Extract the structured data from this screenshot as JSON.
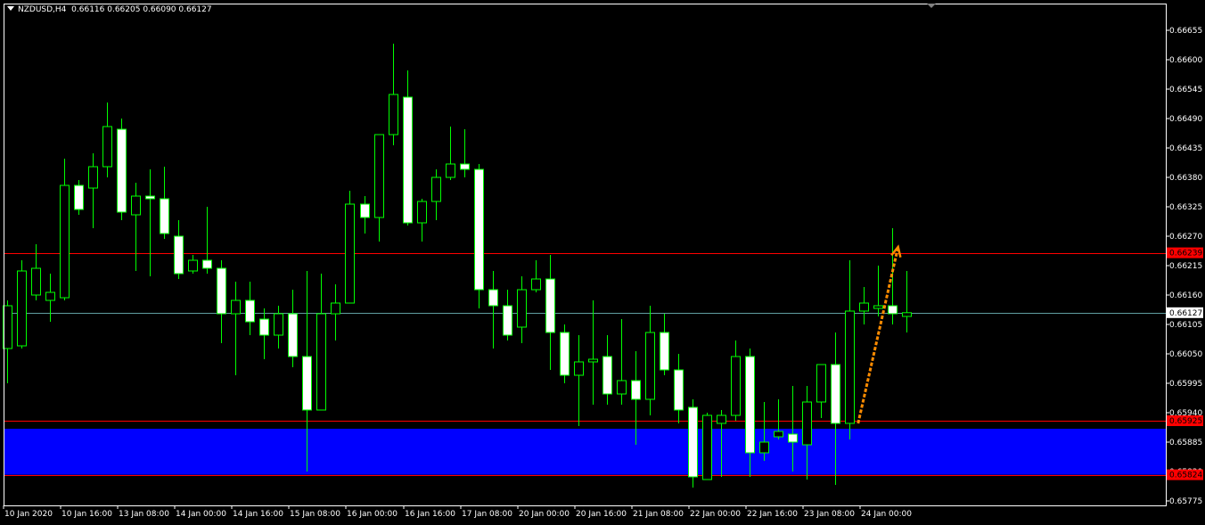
{
  "header": {
    "symbol": "NZDUSD,H4",
    "ohlc": "0.66116 0.66205 0.66090 0.66127"
  },
  "colors": {
    "background": "#000000",
    "bull_body": "#000000",
    "bear_body": "#ffffff",
    "candle_outline": "#00ff00",
    "axis_text": "#ffffff",
    "resistance_line": "#ff0000",
    "support_zone": "#0000ff",
    "current_price_line": "#5f9ea0",
    "arrow": "#ff8c00",
    "price_label_red": "#ff0000"
  },
  "chart_data": {
    "type": "candlestick",
    "symbol": "NZDUSD",
    "timeframe": "H4",
    "ylim": [
      0.65775,
      0.66665
    ],
    "y_ticks": [
      "0.66655",
      "0.66600",
      "0.66545",
      "0.66490",
      "0.66435",
      "0.66380",
      "0.66325",
      "0.66270",
      "0.66215",
      "0.66160",
      "0.66105",
      "0.66050",
      "0.65995",
      "0.65940",
      "0.65885",
      "0.65830",
      "0.65775"
    ],
    "y_tick_values": [
      0.66655,
      0.666,
      0.66545,
      0.6649,
      0.66435,
      0.6638,
      0.66325,
      0.6627,
      0.66215,
      0.6616,
      0.66105,
      0.6605,
      0.65995,
      0.6594,
      0.65885,
      0.6583,
      0.65775
    ],
    "x_labels": [
      {
        "label": "10 Jan 2020",
        "index": 0
      },
      {
        "label": "10 Jan 16:00",
        "index": 4
      },
      {
        "label": "13 Jan 08:00",
        "index": 8
      },
      {
        "label": "14 Jan 00:00",
        "index": 12
      },
      {
        "label": "14 Jan 16:00",
        "index": 16
      },
      {
        "label": "15 Jan 08:00",
        "index": 20
      },
      {
        "label": "16 Jan 00:00",
        "index": 24
      },
      {
        "label": "16 Jan 16:00",
        "index": 28
      },
      {
        "label": "17 Jan 08:00",
        "index": 32
      },
      {
        "label": "20 Jan 00:00",
        "index": 36
      },
      {
        "label": "20 Jan 16:00",
        "index": 40
      },
      {
        "label": "21 Jan 08:00",
        "index": 44
      },
      {
        "label": "22 Jan 00:00",
        "index": 48
      },
      {
        "label": "22 Jan 16:00",
        "index": 52
      },
      {
        "label": "23 Jan 08:00",
        "index": 56
      },
      {
        "label": "24 Jan 00:00",
        "index": 60
      }
    ],
    "candles": [
      {
        "o": 0.6606,
        "h": 0.6615,
        "l": 0.65995,
        "c": 0.6614
      },
      {
        "o": 0.66065,
        "h": 0.66225,
        "l": 0.6606,
        "c": 0.66205
      },
      {
        "o": 0.6616,
        "h": 0.66255,
        "l": 0.6615,
        "c": 0.6621
      },
      {
        "o": 0.6615,
        "h": 0.662,
        "l": 0.6611,
        "c": 0.66165
      },
      {
        "o": 0.66155,
        "h": 0.66415,
        "l": 0.6615,
        "c": 0.66365
      },
      {
        "o": 0.66365,
        "h": 0.66375,
        "l": 0.6631,
        "c": 0.6632
      },
      {
        "o": 0.6636,
        "h": 0.66425,
        "l": 0.66285,
        "c": 0.664
      },
      {
        "o": 0.664,
        "h": 0.6652,
        "l": 0.6638,
        "c": 0.66475
      },
      {
        "o": 0.6647,
        "h": 0.6649,
        "l": 0.663,
        "c": 0.66315
      },
      {
        "o": 0.6631,
        "h": 0.6637,
        "l": 0.66205,
        "c": 0.66345
      },
      {
        "o": 0.66345,
        "h": 0.66395,
        "l": 0.66195,
        "c": 0.6634
      },
      {
        "o": 0.6634,
        "h": 0.664,
        "l": 0.66265,
        "c": 0.66275
      },
      {
        "o": 0.6627,
        "h": 0.663,
        "l": 0.6619,
        "c": 0.662
      },
      {
        "o": 0.66205,
        "h": 0.66235,
        "l": 0.662,
        "c": 0.66225
      },
      {
        "o": 0.66225,
        "h": 0.66325,
        "l": 0.662,
        "c": 0.6621
      },
      {
        "o": 0.6621,
        "h": 0.66225,
        "l": 0.6607,
        "c": 0.66125
      },
      {
        "o": 0.66125,
        "h": 0.66185,
        "l": 0.6601,
        "c": 0.6615
      },
      {
        "o": 0.6615,
        "h": 0.66185,
        "l": 0.66085,
        "c": 0.6611
      },
      {
        "o": 0.66115,
        "h": 0.66135,
        "l": 0.6604,
        "c": 0.66085
      },
      {
        "o": 0.66085,
        "h": 0.6614,
        "l": 0.6606,
        "c": 0.66125
      },
      {
        "o": 0.66125,
        "h": 0.6617,
        "l": 0.66025,
        "c": 0.66045
      },
      {
        "o": 0.66045,
        "h": 0.66205,
        "l": 0.6583,
        "c": 0.65945
      },
      {
        "o": 0.65945,
        "h": 0.662,
        "l": 0.65945,
        "c": 0.66125
      },
      {
        "o": 0.66125,
        "h": 0.6618,
        "l": 0.66075,
        "c": 0.66145
      },
      {
        "o": 0.66145,
        "h": 0.66355,
        "l": 0.66145,
        "c": 0.6633
      },
      {
        "o": 0.6633,
        "h": 0.66345,
        "l": 0.66275,
        "c": 0.66305
      },
      {
        "o": 0.66305,
        "h": 0.66455,
        "l": 0.6626,
        "c": 0.6646
      },
      {
        "o": 0.6646,
        "h": 0.6663,
        "l": 0.6644,
        "c": 0.66535
      },
      {
        "o": 0.6653,
        "h": 0.6658,
        "l": 0.6629,
        "c": 0.66295
      },
      {
        "o": 0.66295,
        "h": 0.6634,
        "l": 0.6626,
        "c": 0.66335
      },
      {
        "o": 0.66335,
        "h": 0.66395,
        "l": 0.663,
        "c": 0.6638
      },
      {
        "o": 0.6638,
        "h": 0.66475,
        "l": 0.66375,
        "c": 0.66405
      },
      {
        "o": 0.66405,
        "h": 0.6647,
        "l": 0.6638,
        "c": 0.66395
      },
      {
        "o": 0.66395,
        "h": 0.66405,
        "l": 0.66135,
        "c": 0.6617
      },
      {
        "o": 0.6617,
        "h": 0.66205,
        "l": 0.6606,
        "c": 0.6614
      },
      {
        "o": 0.6614,
        "h": 0.6617,
        "l": 0.66075,
        "c": 0.66085
      },
      {
        "o": 0.661,
        "h": 0.66195,
        "l": 0.6607,
        "c": 0.6617
      },
      {
        "o": 0.6617,
        "h": 0.66225,
        "l": 0.66165,
        "c": 0.6619
      },
      {
        "o": 0.6619,
        "h": 0.66235,
        "l": 0.6602,
        "c": 0.6609
      },
      {
        "o": 0.6609,
        "h": 0.66105,
        "l": 0.65995,
        "c": 0.6601
      },
      {
        "o": 0.6601,
        "h": 0.66085,
        "l": 0.65915,
        "c": 0.66035
      },
      {
        "o": 0.66035,
        "h": 0.6615,
        "l": 0.65955,
        "c": 0.6604
      },
      {
        "o": 0.66045,
        "h": 0.66085,
        "l": 0.65955,
        "c": 0.65975
      },
      {
        "o": 0.65975,
        "h": 0.66115,
        "l": 0.65955,
        "c": 0.66
      },
      {
        "o": 0.66,
        "h": 0.66055,
        "l": 0.6588,
        "c": 0.65965
      },
      {
        "o": 0.65965,
        "h": 0.6614,
        "l": 0.65935,
        "c": 0.6609
      },
      {
        "o": 0.6609,
        "h": 0.66125,
        "l": 0.6601,
        "c": 0.6602
      },
      {
        "o": 0.6602,
        "h": 0.6605,
        "l": 0.6592,
        "c": 0.65945
      },
      {
        "o": 0.6595,
        "h": 0.65965,
        "l": 0.658,
        "c": 0.6582
      },
      {
        "o": 0.65815,
        "h": 0.6594,
        "l": 0.65815,
        "c": 0.65935
      },
      {
        "o": 0.6592,
        "h": 0.65945,
        "l": 0.6582,
        "c": 0.65935
      },
      {
        "o": 0.65935,
        "h": 0.66075,
        "l": 0.65925,
        "c": 0.66045
      },
      {
        "o": 0.66045,
        "h": 0.6606,
        "l": 0.6582,
        "c": 0.65865
      },
      {
        "o": 0.65865,
        "h": 0.6596,
        "l": 0.6585,
        "c": 0.65885
      },
      {
        "o": 0.65895,
        "h": 0.65965,
        "l": 0.6589,
        "c": 0.65905
      },
      {
        "o": 0.659,
        "h": 0.6599,
        "l": 0.6583,
        "c": 0.65885
      },
      {
        "o": 0.6588,
        "h": 0.6599,
        "l": 0.65815,
        "c": 0.6596
      },
      {
        "o": 0.6596,
        "h": 0.6603,
        "l": 0.6593,
        "c": 0.6603
      },
      {
        "o": 0.6603,
        "h": 0.6609,
        "l": 0.65805,
        "c": 0.6592
      },
      {
        "o": 0.6592,
        "h": 0.66225,
        "l": 0.6589,
        "c": 0.6613
      },
      {
        "o": 0.6613,
        "h": 0.66175,
        "l": 0.66105,
        "c": 0.66145
      },
      {
        "o": 0.66135,
        "h": 0.66215,
        "l": 0.6612,
        "c": 0.6614
      },
      {
        "o": 0.6614,
        "h": 0.66285,
        "l": 0.66105,
        "c": 0.66125
      },
      {
        "o": 0.6612,
        "h": 0.66205,
        "l": 0.6609,
        "c": 0.66127
      }
    ],
    "levels": {
      "resistance": 0.66239,
      "support_top": 0.65925,
      "support_zone_top": 0.6591,
      "support_bottom": 0.65824,
      "current": 0.66127
    },
    "price_labels": {
      "resistance": "0.66239",
      "support_top": "0.65925",
      "support_bottom": "0.65824",
      "current": "0.66127"
    },
    "arrow": {
      "from": {
        "index": 59.6,
        "price": 0.6592
      },
      "to": {
        "index": 62.4,
        "price": 0.6625
      }
    }
  }
}
